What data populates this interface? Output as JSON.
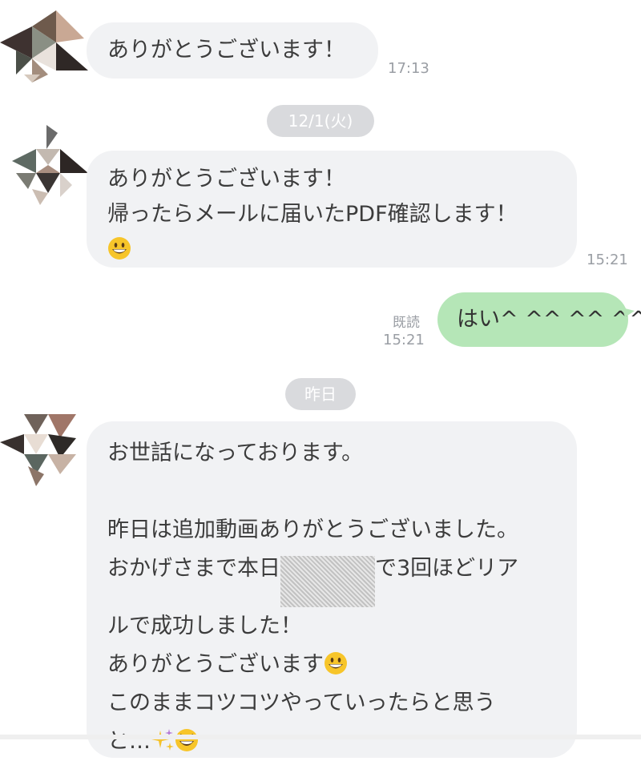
{
  "messages": [
    {
      "id": "m1",
      "text": [
        "ありがとうございます！"
      ],
      "time": "17:13"
    },
    {
      "id": "m2",
      "text": [
        "ありがとうございます！",
        "帰ったらメールに届いたPDF確認します！"
      ],
      "emoji": "grinning-face",
      "time": "15:21"
    },
    {
      "id": "m3",
      "text": [
        "はい^ ^^ ^^ ^^ ^"
      ],
      "read_label": "既読",
      "time": "15:21"
    },
    {
      "id": "m4",
      "line1": "お世話になっております。",
      "line2": "昨日は追加動画ありがとうございました。",
      "line3a": "おかげさまで本日",
      "line3b": "で3回ほどリア",
      "line4": "ルで成功しました！",
      "line5": "ありがとうございます",
      "line6": "このままコツコツやっていったらと思う",
      "line7": "と…",
      "emojis": [
        "grinning-face",
        "sparkles",
        "grinning-squinting-face"
      ]
    }
  ],
  "date_separators": [
    "12/1(火)",
    "昨日"
  ],
  "colors": {
    "incoming_bubble": "#f1f2f4",
    "outgoing_bubble": "#b5e6b7",
    "date_pill": "#d9dadd",
    "timestamp": "#9a9ea4"
  }
}
